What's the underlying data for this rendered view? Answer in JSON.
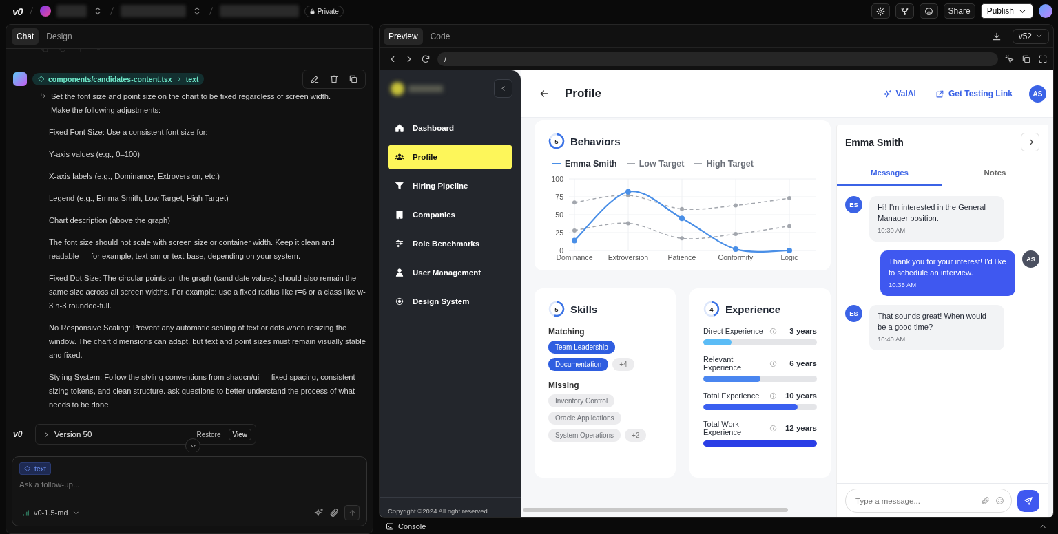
{
  "topbar": {
    "logo": "v0",
    "visibility": "Private",
    "share": "Share",
    "publish": "Publish"
  },
  "chat_panel": {
    "tabs": [
      {
        "label": "Chat",
        "selected": true
      },
      {
        "label": "Design",
        "selected": false
      }
    ],
    "message": {
      "context_path": "components/candidates-content.tsx",
      "context_target": "text",
      "reply_to": "Set the font size and point size on the chart to be fixed regardless of screen width.\nMake the following adjustments:",
      "paragraphs": [
        "Fixed Font Size: Use a consistent font size for:",
        "Y-axis values (e.g., 0–100)",
        "X-axis labels (e.g., Dominance, Extroversion, etc.)",
        "Legend (e.g., Emma Smith, Low Target, High Target)",
        "Chart description (above the graph)",
        "The font size should not scale with screen size or container width. Keep it clean and readable — for example, text-sm or text-base, depending on your system.",
        "Fixed Dot Size: The circular points on the graph (candidate values) should also remain the same size across all screen widths. For example: use a fixed radius like r=6 or a class like w-3 h-3 rounded-full.",
        "No Responsive Scaling: Prevent any automatic scaling of text or dots when resizing the window. The chart dimensions can adapt, but text and point sizes must remain visually stable and fixed.",
        "Styling System: Follow the styling conventions from shadcn/ui — fixed spacing, consistent sizing tokens, and clean structure. ask questions to better understand the process of what needs to be done"
      ]
    },
    "version": {
      "logo": "v0",
      "label": "Version 50",
      "restore": "Restore",
      "view": "View"
    },
    "composer": {
      "chip": "text",
      "placeholder": "Ask a follow-up...",
      "model": "v0-1.5-md"
    }
  },
  "preview_panel": {
    "tabs": [
      {
        "label": "Preview",
        "selected": true
      },
      {
        "label": "Code",
        "selected": false
      }
    ],
    "version": "v52",
    "url": "/",
    "console": "Console"
  },
  "app": {
    "sidebar": {
      "items": [
        {
          "label": "Dashboard",
          "selected": false
        },
        {
          "label": "Profile",
          "selected": true
        },
        {
          "label": "Hiring Pipeline",
          "selected": false
        },
        {
          "label": "Companies",
          "selected": false
        },
        {
          "label": "Role Benchmarks",
          "selected": false
        },
        {
          "label": "User Management",
          "selected": false
        },
        {
          "label": "Design System",
          "selected": false
        }
      ],
      "copyright": "Copyright ©2024 All right reserved"
    },
    "header": {
      "title": "Profile",
      "ai_link": "ValAI",
      "testing_link": "Get Testing Link",
      "avatar": "AS"
    },
    "behaviors": {
      "score": "5",
      "level": 0.8,
      "title": "Behaviors",
      "chart_data": {
        "type": "line",
        "categories": [
          "Dominance",
          "Extroversion",
          "Patience",
          "Conformity",
          "Logic"
        ],
        "ylim": [
          0,
          100
        ],
        "yticks": [
          0,
          25,
          50,
          75,
          100
        ],
        "grid": true,
        "series": [
          {
            "name": "Emma Smith",
            "color": "#4a8fe7",
            "line_style": "solid",
            "marker": "circle",
            "values": [
              14,
              82,
              45,
              2,
              0
            ]
          },
          {
            "name": "Low Target",
            "color": "#a3a7ae",
            "line_style": "dashed",
            "marker": "circle",
            "values": [
              28,
              38,
              17,
              23,
              34
            ]
          },
          {
            "name": "High Target",
            "color": "#a3a7ae",
            "line_style": "dashed",
            "marker": "circle",
            "values": [
              67,
              77,
              58,
              63,
              73
            ]
          }
        ]
      }
    },
    "skills": {
      "score": "5",
      "level": 0.55,
      "title": "Skills",
      "groups": [
        {
          "title": "Matching",
          "kind": "matching",
          "chips": [
            "Team Leadership",
            "Documentation"
          ],
          "more": "+4"
        },
        {
          "title": "Missing",
          "kind": "missing",
          "chips": [
            "Inventory Control",
            "Oracle Applications",
            "System Operations"
          ],
          "more": "+2"
        }
      ]
    },
    "experience": {
      "score": "4",
      "level": 0.45,
      "title": "Experience",
      "items": [
        {
          "label": "Direct Experience",
          "value": "3 years",
          "level": 0.25,
          "color": "#5bbcf6"
        },
        {
          "label": "Relevant Experience",
          "value": "6 years",
          "level": 0.5,
          "color": "#4a86f0"
        },
        {
          "label": "Total Experience",
          "value": "10 years",
          "level": 0.83,
          "color": "#3a5ff0"
        },
        {
          "label": "Total Work Experience",
          "value": "12 years",
          "level": 1,
          "color": "#2a3ee6"
        }
      ]
    },
    "chat": {
      "name": "Emma Smith",
      "tabs": [
        {
          "label": "Messages",
          "selected": true
        },
        {
          "label": "Notes",
          "selected": false
        }
      ],
      "messages": [
        {
          "kind": "incoming",
          "avatar": "ES",
          "text": "Hi! I'm interested in the General Manager position.",
          "time": "10:30 AM"
        },
        {
          "kind": "outgoing",
          "avatar": "AS",
          "text": "Thank you for your interest! I'd like to schedule an interview.",
          "time": "10:35 AM"
        },
        {
          "kind": "incoming",
          "avatar": "ES",
          "text": "That sounds great! When would be a good time?",
          "time": "10:40 AM"
        }
      ],
      "placeholder": "Type a message..."
    }
  }
}
